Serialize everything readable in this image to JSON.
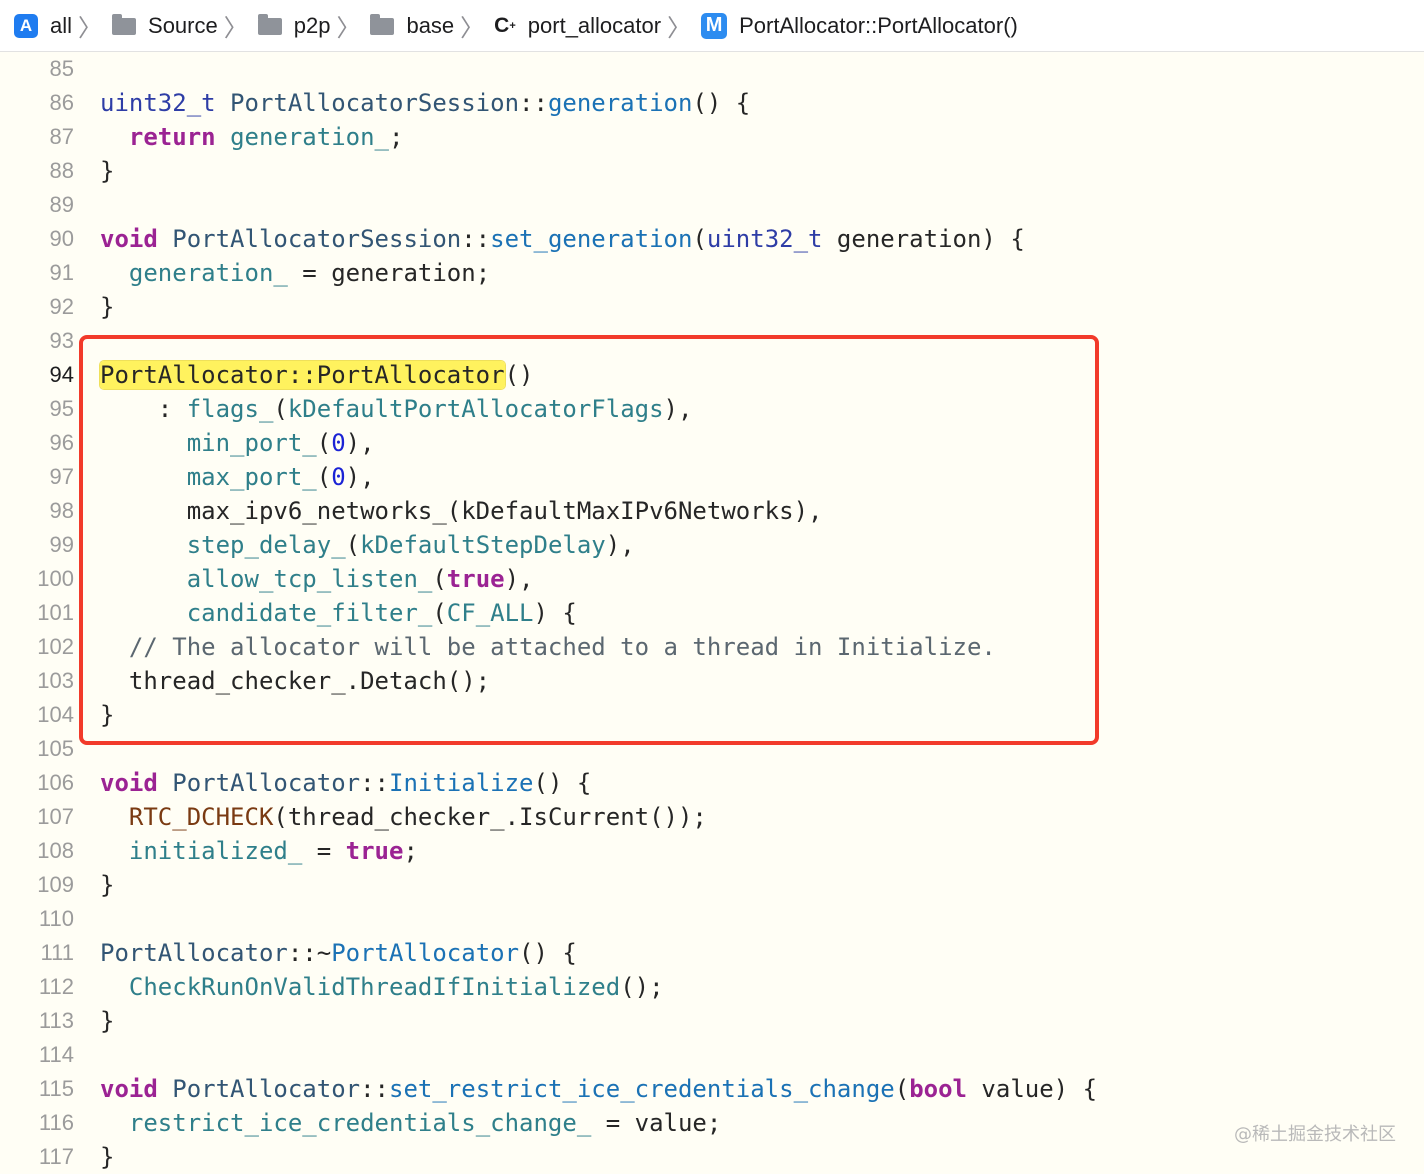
{
  "breadcrumb": {
    "items": [
      {
        "label": "all",
        "icon": "xcode-project-icon"
      },
      {
        "label": "Source",
        "icon": "folder-icon"
      },
      {
        "label": "p2p",
        "icon": "folder-icon"
      },
      {
        "label": "base",
        "icon": "folder-icon"
      },
      {
        "label": "port_allocator",
        "icon": "cpp-file-icon"
      },
      {
        "label": "PortAllocator::PortAllocator()",
        "icon": "method-icon"
      }
    ],
    "project_icon_glyph": "A",
    "cpp_glyph": "C",
    "cpp_sup": "+",
    "method_glyph": "M"
  },
  "editor": {
    "current_line": "94",
    "lines": [
      {
        "n": "85",
        "tokens": []
      },
      {
        "n": "86",
        "tokens": [
          [
            "type",
            "uint32_t"
          ],
          [
            "plain",
            " "
          ],
          [
            "cls",
            "PortAllocatorSession"
          ],
          [
            "plain",
            "::"
          ],
          [
            "fn",
            "generation"
          ],
          [
            "plain",
            "() {"
          ]
        ]
      },
      {
        "n": "87",
        "tokens": [
          [
            "plain",
            "  "
          ],
          [
            "kw",
            "return"
          ],
          [
            "plain",
            " "
          ],
          [
            "mem",
            "generation_"
          ],
          [
            "plain",
            ";"
          ]
        ]
      },
      {
        "n": "88",
        "tokens": [
          [
            "plain",
            "}"
          ]
        ]
      },
      {
        "n": "89",
        "tokens": []
      },
      {
        "n": "90",
        "tokens": [
          [
            "kw",
            "void"
          ],
          [
            "plain",
            " "
          ],
          [
            "cls",
            "PortAllocatorSession"
          ],
          [
            "plain",
            "::"
          ],
          [
            "fn",
            "set_generation"
          ],
          [
            "plain",
            "("
          ],
          [
            "type",
            "uint32_t"
          ],
          [
            "plain",
            " generation) {"
          ]
        ]
      },
      {
        "n": "91",
        "tokens": [
          [
            "plain",
            "  "
          ],
          [
            "mem",
            "generation_"
          ],
          [
            "plain",
            " = generation;"
          ]
        ]
      },
      {
        "n": "92",
        "tokens": [
          [
            "plain",
            "}"
          ]
        ]
      },
      {
        "n": "93",
        "tokens": []
      },
      {
        "n": "94",
        "tokens": [
          [
            "hl",
            "PortAllocator::PortAllocator"
          ],
          [
            "plain",
            "()"
          ]
        ]
      },
      {
        "n": "95",
        "tokens": [
          [
            "plain",
            "    : "
          ],
          [
            "mem",
            "flags_"
          ],
          [
            "plain",
            "("
          ],
          [
            "mem",
            "kDefaultPortAllocatorFlags"
          ],
          [
            "plain",
            "),"
          ]
        ]
      },
      {
        "n": "96",
        "tokens": [
          [
            "plain",
            "      "
          ],
          [
            "mem",
            "min_port_"
          ],
          [
            "plain",
            "("
          ],
          [
            "num",
            "0"
          ],
          [
            "plain",
            "),"
          ]
        ]
      },
      {
        "n": "97",
        "tokens": [
          [
            "plain",
            "      "
          ],
          [
            "mem",
            "max_port_"
          ],
          [
            "plain",
            "("
          ],
          [
            "num",
            "0"
          ],
          [
            "plain",
            "),"
          ]
        ]
      },
      {
        "n": "98",
        "tokens": [
          [
            "plain",
            "      max_ipv6_networks_(kDefaultMaxIPv6Networks),"
          ]
        ]
      },
      {
        "n": "99",
        "tokens": [
          [
            "plain",
            "      "
          ],
          [
            "mem",
            "step_delay_"
          ],
          [
            "plain",
            "("
          ],
          [
            "mem",
            "kDefaultStepDelay"
          ],
          [
            "plain",
            "),"
          ]
        ]
      },
      {
        "n": "100",
        "tokens": [
          [
            "plain",
            "      "
          ],
          [
            "mem",
            "allow_tcp_listen_"
          ],
          [
            "plain",
            "("
          ],
          [
            "kw",
            "true"
          ],
          [
            "plain",
            "),"
          ]
        ]
      },
      {
        "n": "101",
        "tokens": [
          [
            "plain",
            "      "
          ],
          [
            "mem",
            "candidate_filter_"
          ],
          [
            "plain",
            "("
          ],
          [
            "mem",
            "CF_ALL"
          ],
          [
            "plain",
            ") {"
          ]
        ]
      },
      {
        "n": "102",
        "tokens": [
          [
            "plain",
            "  "
          ],
          [
            "com",
            "// The allocator will be attached to a thread in Initialize."
          ]
        ]
      },
      {
        "n": "103",
        "tokens": [
          [
            "plain",
            "  thread_checker_.Detach();"
          ]
        ]
      },
      {
        "n": "104",
        "tokens": [
          [
            "plain",
            "}"
          ]
        ]
      },
      {
        "n": "105",
        "tokens": []
      },
      {
        "n": "106",
        "tokens": [
          [
            "kw",
            "void"
          ],
          [
            "plain",
            " "
          ],
          [
            "cls",
            "PortAllocator"
          ],
          [
            "plain",
            "::"
          ],
          [
            "fn",
            "Initialize"
          ],
          [
            "plain",
            "() {"
          ]
        ]
      },
      {
        "n": "107",
        "tokens": [
          [
            "plain",
            "  "
          ],
          [
            "mac",
            "RTC_DCHECK"
          ],
          [
            "plain",
            "(thread_checker_.IsCurrent());"
          ]
        ]
      },
      {
        "n": "108",
        "tokens": [
          [
            "plain",
            "  "
          ],
          [
            "mem",
            "initialized_"
          ],
          [
            "plain",
            " = "
          ],
          [
            "kw",
            "true"
          ],
          [
            "plain",
            ";"
          ]
        ]
      },
      {
        "n": "109",
        "tokens": [
          [
            "plain",
            "}"
          ]
        ]
      },
      {
        "n": "110",
        "tokens": []
      },
      {
        "n": "111",
        "tokens": [
          [
            "cls",
            "PortAllocator"
          ],
          [
            "plain",
            "::~"
          ],
          [
            "fn",
            "PortAllocator"
          ],
          [
            "plain",
            "() {"
          ]
        ]
      },
      {
        "n": "112",
        "tokens": [
          [
            "plain",
            "  "
          ],
          [
            "mem",
            "CheckRunOnValidThreadIfInitialized"
          ],
          [
            "plain",
            "();"
          ]
        ]
      },
      {
        "n": "113",
        "tokens": [
          [
            "plain",
            "}"
          ]
        ]
      },
      {
        "n": "114",
        "tokens": []
      },
      {
        "n": "115",
        "tokens": [
          [
            "kw",
            "void"
          ],
          [
            "plain",
            " "
          ],
          [
            "cls",
            "PortAllocator"
          ],
          [
            "plain",
            "::"
          ],
          [
            "fn",
            "set_restrict_ice_credentials_change"
          ],
          [
            "plain",
            "("
          ],
          [
            "kw",
            "bool"
          ],
          [
            "plain",
            " value) {"
          ]
        ]
      },
      {
        "n": "116",
        "tokens": [
          [
            "plain",
            "  "
          ],
          [
            "mem",
            "restrict_ice_credentials_change_"
          ],
          [
            "plain",
            " = value;"
          ]
        ]
      },
      {
        "n": "117",
        "tokens": [
          [
            "plain",
            "}"
          ]
        ]
      }
    ]
  },
  "highlight_box": {
    "color": "#f23a2a",
    "from_line": "93",
    "to_line": "105"
  },
  "watermark": "@稀土掘金技术社区"
}
